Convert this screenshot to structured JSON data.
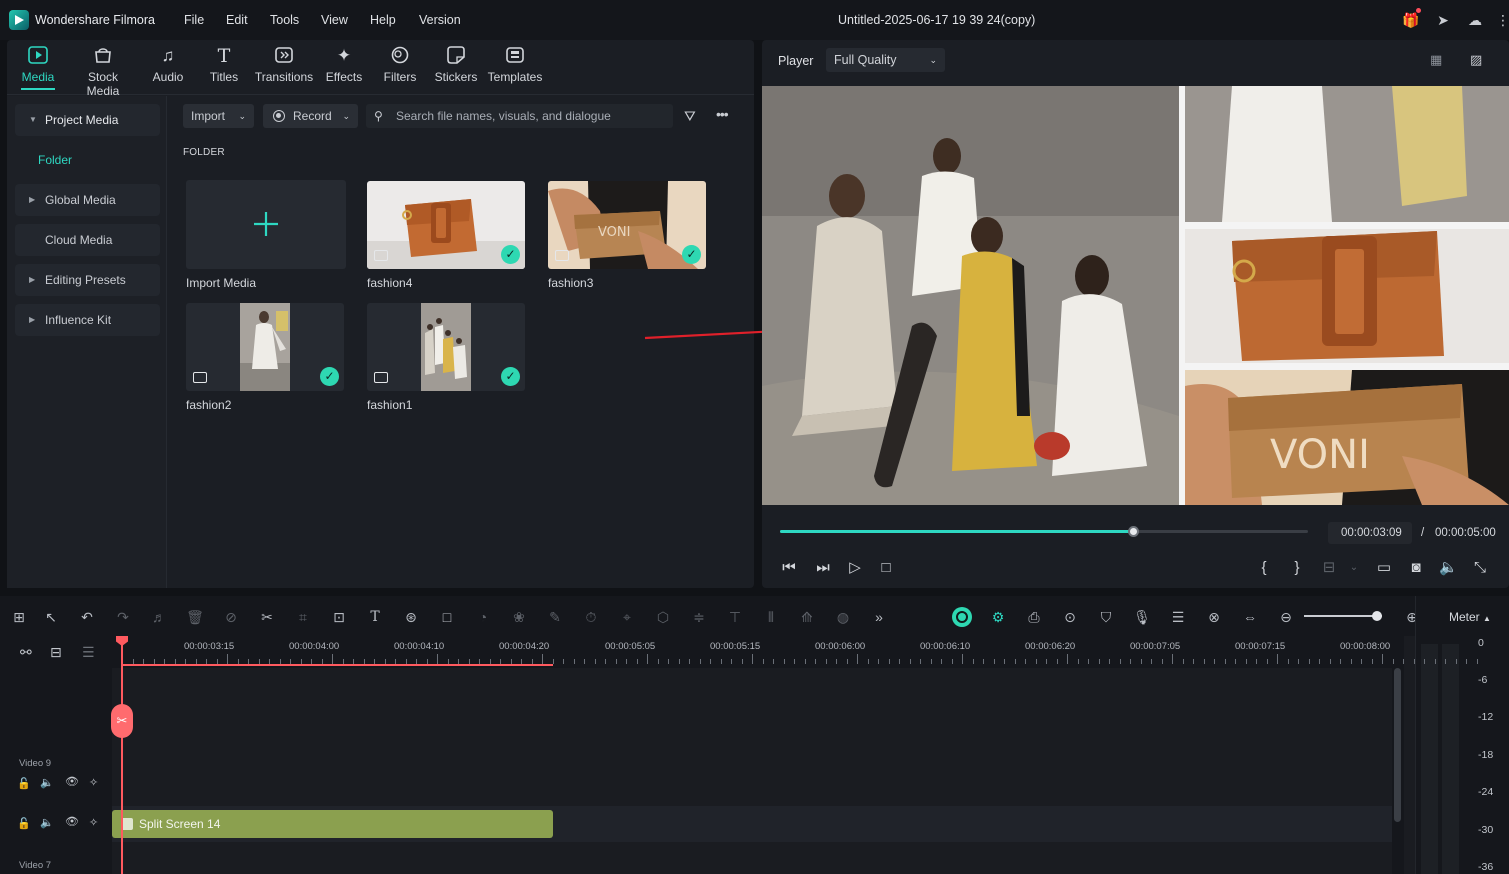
{
  "app": {
    "name": "Wondershare Filmora",
    "menu": [
      "File",
      "Edit",
      "Tools",
      "View",
      "Help",
      "Version"
    ],
    "document_title": "Untitled-2025-06-17 19 39 24(copy)"
  },
  "tabs": [
    {
      "label": "Media",
      "icon": "media-icon"
    },
    {
      "label": "Stock Media",
      "icon": "stock-media-icon"
    },
    {
      "label": "Audio",
      "icon": "audio-icon"
    },
    {
      "label": "Titles",
      "icon": "titles-icon"
    },
    {
      "label": "Transitions",
      "icon": "transitions-icon"
    },
    {
      "label": "Effects",
      "icon": "effects-icon"
    },
    {
      "label": "Filters",
      "icon": "filters-icon"
    },
    {
      "label": "Stickers",
      "icon": "stickers-icon"
    },
    {
      "label": "Templates",
      "icon": "templates-icon"
    }
  ],
  "sidebar": {
    "items": [
      "Project Media",
      "Global Media",
      "Cloud Media",
      "Editing Presets",
      "Influence Kit"
    ],
    "folder": "Folder"
  },
  "media_toolbar": {
    "import": "Import",
    "record": "Record",
    "search_placeholder": "Search file names, visuals, and dialogue"
  },
  "folder_label": "FOLDER",
  "media": {
    "import_label": "Import Media",
    "items": [
      "fashion4",
      "fashion3",
      "fashion2",
      "fashion1"
    ]
  },
  "player": {
    "label": "Player",
    "quality": "Full Quality",
    "current_time": "00:00:03:09",
    "separator": "/",
    "total_time": "00:00:05:00",
    "progress": 0.67,
    "brand_text": "VONI"
  },
  "timeline": {
    "ruler": [
      "00:00:03:15",
      "00:00:04:00",
      "00:00:04:10",
      "00:00:04:20",
      "00:00:05:05",
      "00:00:05:15",
      "00:00:06:00",
      "00:00:06:10",
      "00:00:06:20",
      "00:00:07:05",
      "00:00:07:15",
      "00:00:08:00"
    ],
    "tracks": [
      "Video 9",
      "Video 7"
    ],
    "clip": "Split Screen 14",
    "meter_label": "Meter",
    "meter_scale": [
      "0",
      "-6",
      "-12",
      "-18",
      "-24",
      "-30",
      "-36"
    ]
  },
  "colors": {
    "accent": "#2ed8c2",
    "playhead": "#ff5a5f",
    "clip": "#8ba04f",
    "check": "#2ed8b2"
  }
}
